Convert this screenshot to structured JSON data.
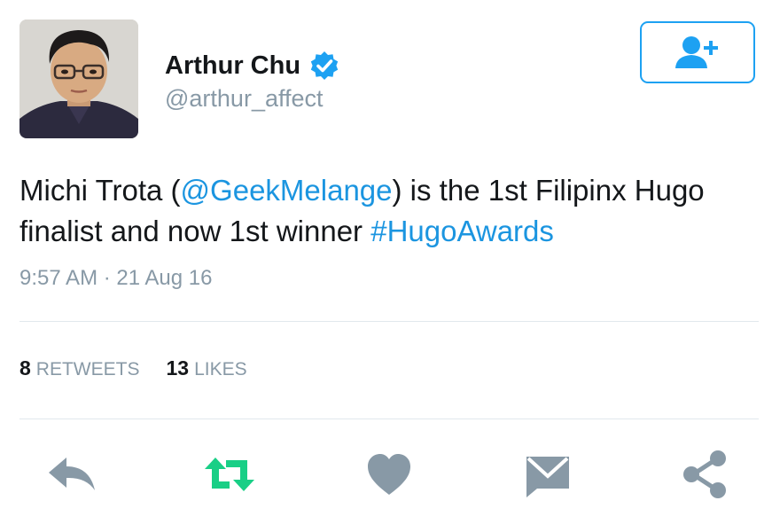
{
  "author": {
    "display_name": "Arthur Chu",
    "handle": "@arthur_affect",
    "verified": true,
    "avatar_icon": "profile-photo"
  },
  "follow_button": {
    "icon": "follow-user-plus-icon",
    "color": "#1da1f2"
  },
  "tweet": {
    "text_part1": "Michi Trota (",
    "mention": "@GeekMelange",
    "text_part2": ") is the 1st Filipinx Hugo finalist and now 1st winner ",
    "hashtag": "#HugoAwards",
    "timestamp": "9:57 AM · 21 Aug 16"
  },
  "stats": {
    "retweets_count": "8",
    "retweets_label": "RETWEETS",
    "likes_count": "13",
    "likes_label": "LIKES"
  },
  "actions": {
    "reply_icon": "reply-icon",
    "retweet_icon": "retweet-icon",
    "like_icon": "heart-icon",
    "dm_icon": "envelope-icon",
    "share_icon": "share-icon",
    "retweet_color": "#19cf86",
    "icon_color": "#8899a6"
  },
  "colors": {
    "link": "#1b95e0",
    "muted": "#8899a6",
    "verified": "#1da1f2"
  }
}
